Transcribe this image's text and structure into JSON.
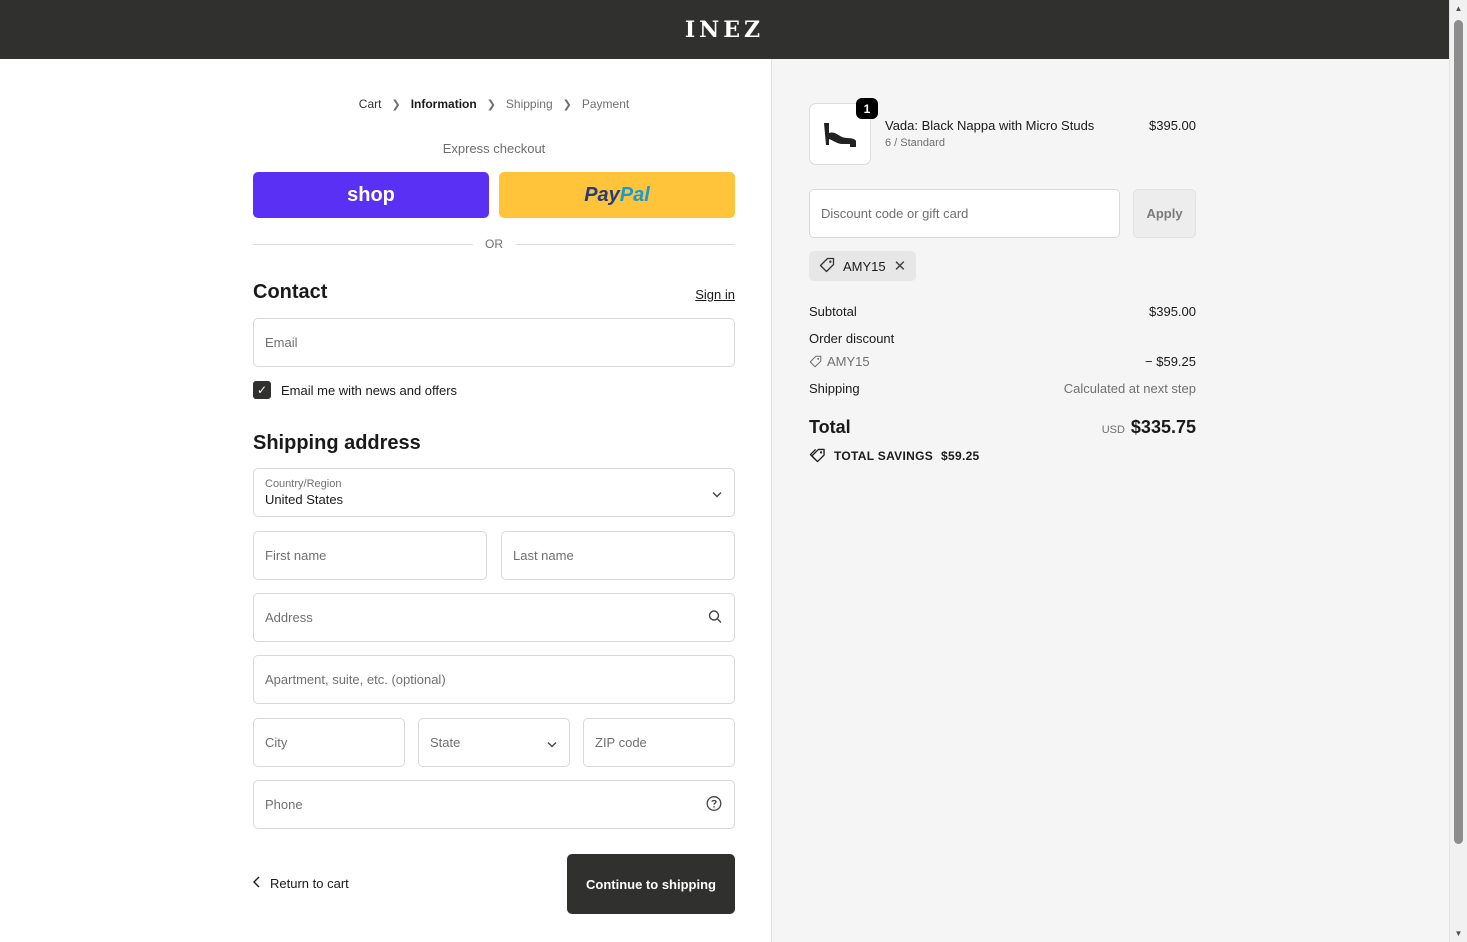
{
  "header": {
    "logo": "INEZ"
  },
  "breadcrumb": {
    "items": [
      {
        "label": "Cart"
      },
      {
        "label": "Information"
      },
      {
        "label": "Shipping"
      },
      {
        "label": "Payment"
      }
    ],
    "current": "Information"
  },
  "express": {
    "title": "Express checkout",
    "shop_label": "shop",
    "paypal_part1": "Pay",
    "paypal_part2": "Pal",
    "or_label": "OR"
  },
  "contact": {
    "title": "Contact",
    "signin_label": "Sign in",
    "email_placeholder": "Email",
    "newsletter_label": "Email me with news and offers",
    "newsletter_checked": true
  },
  "shipping_address": {
    "title": "Shipping address",
    "country_label": "Country/Region",
    "country_value": "United States",
    "first_name_placeholder": "First name",
    "last_name_placeholder": "Last name",
    "address_placeholder": "Address",
    "apartment_placeholder": "Apartment, suite, etc. (optional)",
    "city_placeholder": "City",
    "state_placeholder": "State",
    "zip_placeholder": "ZIP code",
    "phone_placeholder": "Phone"
  },
  "footer_actions": {
    "return_label": "Return to cart",
    "continue_label": "Continue to shipping"
  },
  "order_summary": {
    "product": {
      "name": "Vada: Black Nappa with Micro Studs",
      "variant": "6 / Standard",
      "price": "$395.00",
      "quantity": "1"
    },
    "discount_placeholder": "Discount code or gift card",
    "apply_label": "Apply",
    "applied_code": "AMY15",
    "subtotal_label": "Subtotal",
    "subtotal_value": "$395.00",
    "order_discount_label": "Order discount",
    "order_discount_code": "AMY15",
    "order_discount_value": "− $59.25",
    "shipping_label": "Shipping",
    "shipping_value": "Calculated at next step",
    "total_label": "Total",
    "total_currency": "USD",
    "total_value": "$335.75",
    "savings_label": "TOTAL SAVINGS",
    "savings_value": "$59.25"
  },
  "colors": {
    "header_bg": "#30302e",
    "shop_pay": "#5a31f4",
    "paypal": "#ffc439",
    "primary_button": "#30302e"
  }
}
